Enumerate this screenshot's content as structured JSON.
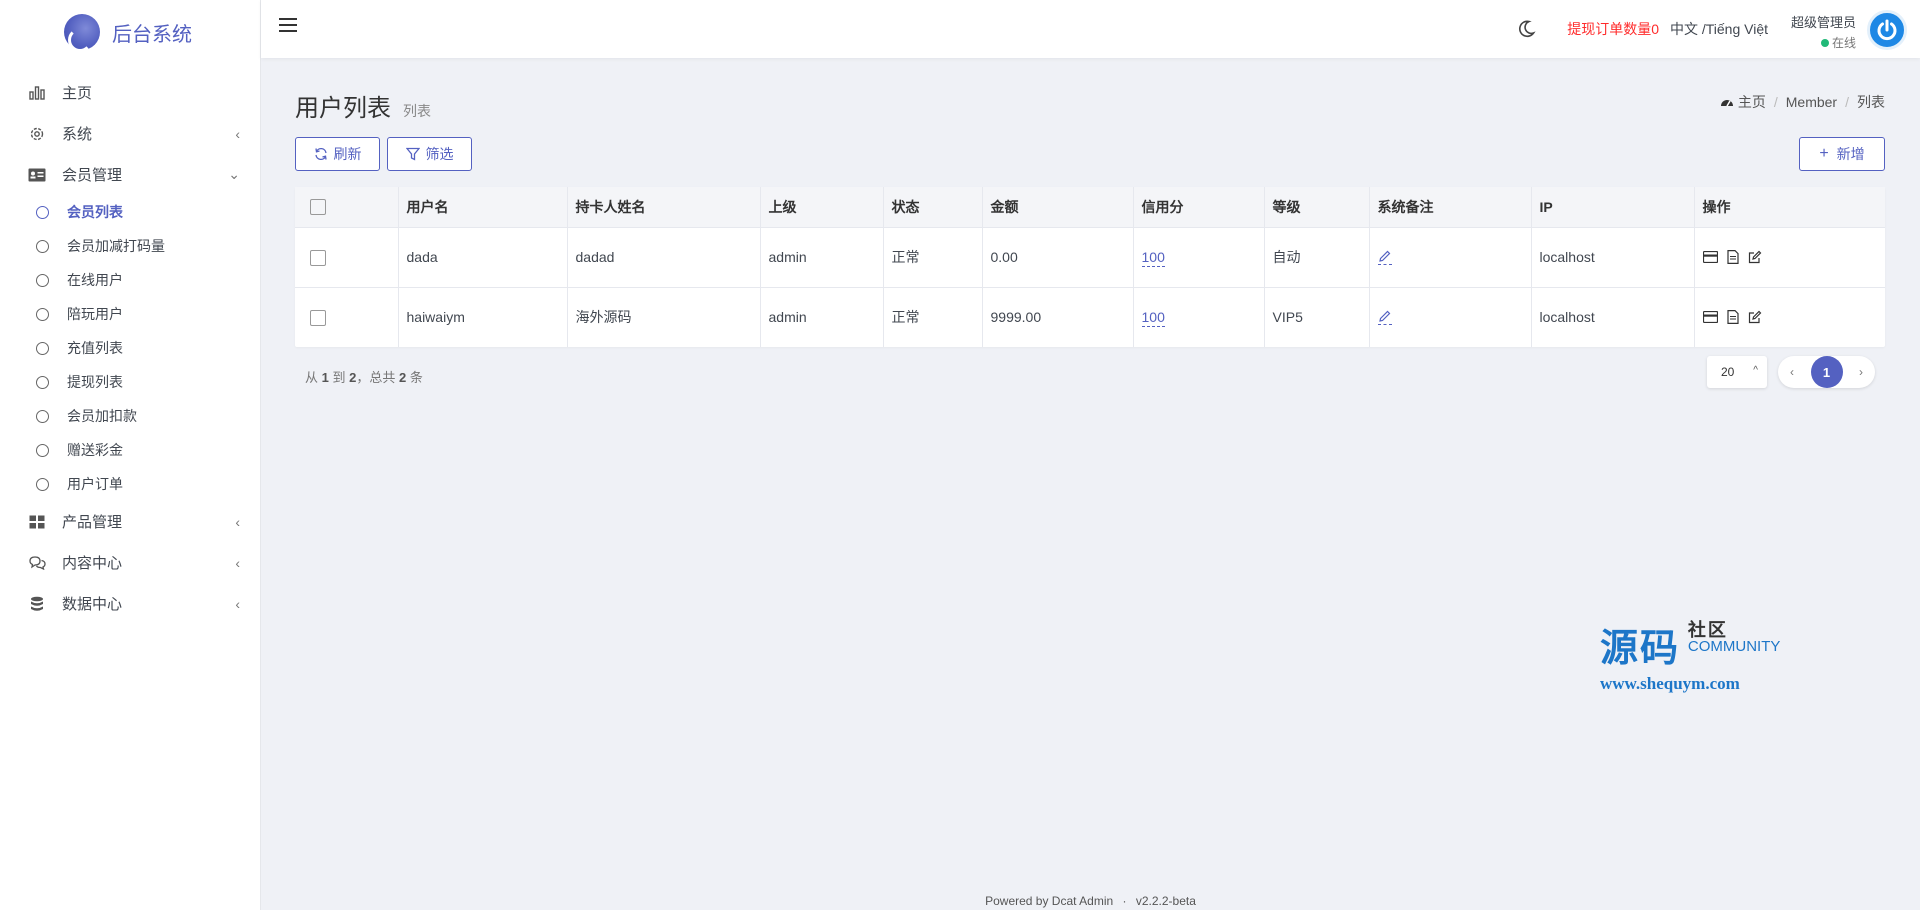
{
  "brand": {
    "name": "后台系统"
  },
  "sidebar": {
    "items": [
      {
        "label": "主页",
        "icon": "bar-chart-icon",
        "chevron": false
      },
      {
        "label": "系统",
        "icon": "gear-icon",
        "chevron": true
      },
      {
        "label": "会员管理",
        "icon": "id-card-icon",
        "chevron": true,
        "expanded": true
      }
    ],
    "sub_items": [
      {
        "label": "会员列表",
        "active": true
      },
      {
        "label": "会员加减打码量"
      },
      {
        "label": "在线用户"
      },
      {
        "label": "陪玩用户"
      },
      {
        "label": "充值列表"
      },
      {
        "label": "提现列表"
      },
      {
        "label": "会员加扣款"
      },
      {
        "label": "赠送彩金"
      },
      {
        "label": "用户订单"
      }
    ],
    "items_after": [
      {
        "label": "产品管理",
        "icon": "grid-icon",
        "chevron": true
      },
      {
        "label": "内容中心",
        "icon": "chat-icon",
        "chevron": true
      },
      {
        "label": "数据中心",
        "icon": "database-icon",
        "chevron": true
      }
    ]
  },
  "header": {
    "withdraw_text": "提现订单数量0",
    "lang_text": "中文 /Tiếng Việt",
    "user_name": "超级管理员",
    "user_status": "在线"
  },
  "page": {
    "title": "用户列表",
    "subtitle": "列表",
    "breadcrumb": [
      "主页",
      "Member",
      "列表"
    ]
  },
  "toolbar": {
    "refresh_label": "刷新",
    "filter_label": "筛选",
    "add_label": "新增"
  },
  "table": {
    "columns": [
      "用户名",
      "持卡人姓名",
      "上级",
      "状态",
      "金额",
      "信用分",
      "等级",
      "系统备注",
      "IP",
      "操作"
    ],
    "rows": [
      {
        "username": "dada",
        "cardholder": "dadad",
        "parent": "admin",
        "status": "正常",
        "amount": "0.00",
        "credit": "100",
        "level": "自动",
        "ip": "localhost"
      },
      {
        "username": "haiwaiym",
        "cardholder": "海外源码",
        "parent": "admin",
        "status": "正常",
        "amount": "9999.00",
        "credit": "100",
        "level": "VIP5",
        "ip": "localhost"
      }
    ]
  },
  "pagination": {
    "summary_prefix": "从",
    "from": "1",
    "to_word": "到",
    "to": "2",
    "total_word": "，总共",
    "total": "2",
    "unit": "条",
    "per_page": "20",
    "current_page": "1"
  },
  "watermark": {
    "big": "源码",
    "small": "社区",
    "community": "COMMUNITY",
    "url": "www.shequym.com"
  },
  "footer": {
    "powered": "Powered by Dcat Admin",
    "sep": "·",
    "version": "v2.2.2-beta"
  },
  "colors": {
    "primary": "#5461c1",
    "alert": "#ff2b2b",
    "online": "#21b978",
    "background": "#eff1f6"
  }
}
